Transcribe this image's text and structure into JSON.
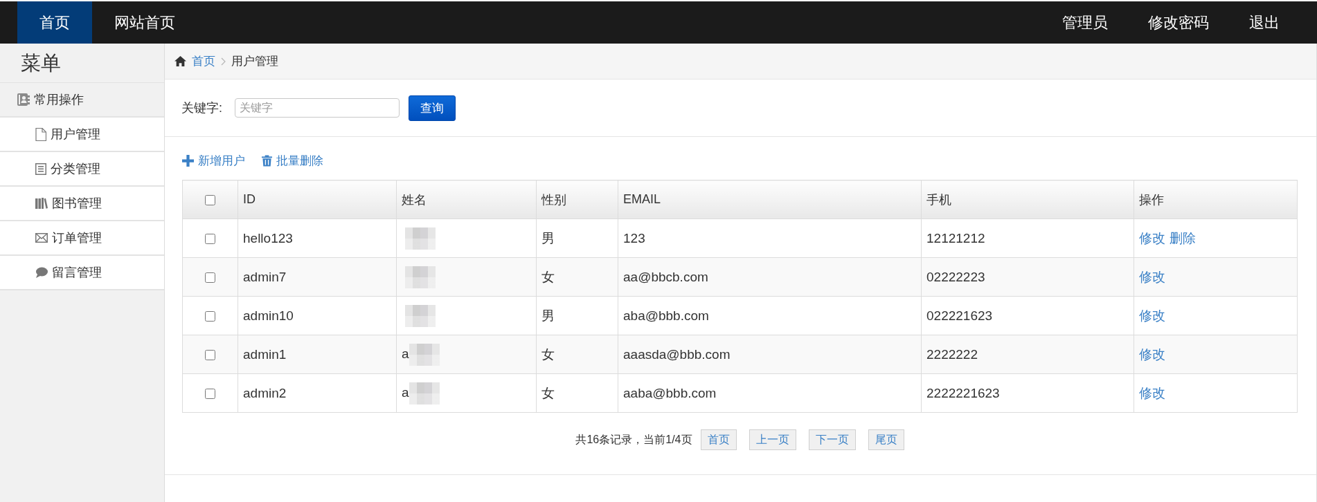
{
  "nav": {
    "left": [
      {
        "label": "首页",
        "selected": true
      },
      {
        "label": "网站首页",
        "selected": false
      }
    ],
    "right": [
      "管理员",
      "修改密码",
      "退出"
    ]
  },
  "sidebar": {
    "title": "菜单",
    "group": {
      "label": "常用操作",
      "items": [
        "用户管理",
        "分类管理",
        "图书管理",
        "订单管理",
        "留言管理"
      ]
    }
  },
  "breadcrumb": [
    "首页",
    "用户管理"
  ],
  "search": {
    "label": "关键字:",
    "placeholder": "关键字",
    "button": "查询"
  },
  "toolbar": [
    "新增用户",
    "批量删除"
  ],
  "table": {
    "header_checked": false,
    "columns": [
      "ID",
      "姓名",
      "性别",
      "EMAIL",
      "手机",
      "操作"
    ],
    "rows": [
      {
        "checked": false,
        "id": "hello123",
        "name_redacted": true,
        "gender": "男",
        "email": "123",
        "phone": "12121212",
        "actions": [
          "修改",
          "删除"
        ]
      },
      {
        "checked": false,
        "id": "admin7",
        "name_redacted": true,
        "gender": "女",
        "email": "aa@bbcb.com",
        "phone": "02222223",
        "actions": [
          "修改"
        ]
      },
      {
        "checked": false,
        "id": "admin10",
        "name_redacted": true,
        "gender": "男",
        "email": "aba@bbb.com",
        "phone": "022221623",
        "actions": [
          "修改"
        ]
      },
      {
        "checked": false,
        "id": "admin1",
        "name": "a",
        "name_redacted": true,
        "gender": "女",
        "email": "aaasda@bbb.com",
        "phone": "2222222",
        "actions": [
          "修改"
        ]
      },
      {
        "checked": false,
        "id": "admin2",
        "name": "a",
        "name_redacted": true,
        "gender": "女",
        "email": "aaba@bbb.com",
        "phone": "2222221623",
        "actions": [
          "修改"
        ]
      }
    ]
  },
  "pagination": {
    "summary": "共16条记录，当前1/4页",
    "buttons": [
      "首页",
      "上一页",
      "下一页",
      "尾页"
    ]
  }
}
